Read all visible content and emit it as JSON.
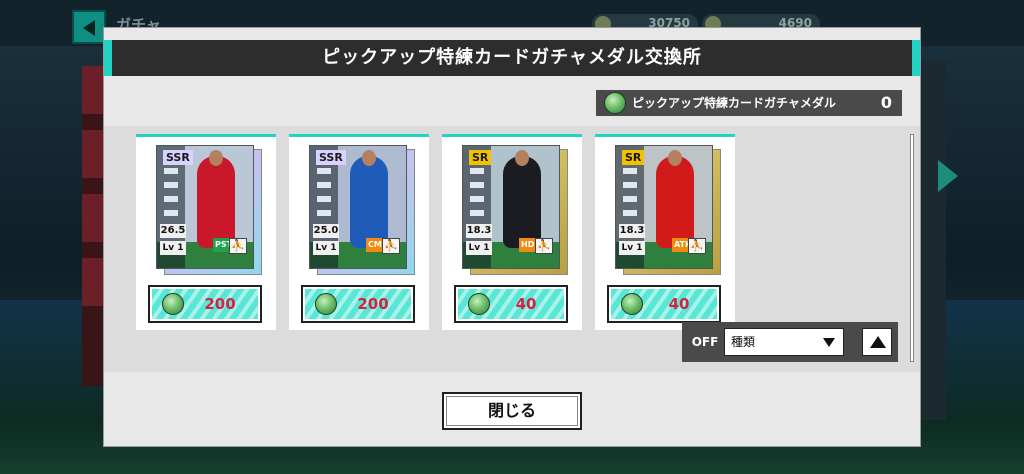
{
  "background": {
    "title": "ガチャ",
    "coin_a": "30750",
    "coin_b": "4690"
  },
  "dialog": {
    "title": "ピックアップ特練カードガチャメダル交換所",
    "medal": {
      "label": "ピックアップ特練カードガチャメダル",
      "count": "0",
      "icon": "medal-icon"
    },
    "cards": [
      {
        "rarity": "SSR",
        "rating": "26.5",
        "level": "Lv 1",
        "position": "PST",
        "position_color": "#1aa54a",
        "price": "200",
        "kit_color": "#c8182a",
        "art_bg": "#b9c7d6"
      },
      {
        "rarity": "SSR",
        "rating": "25.0",
        "level": "Lv 1",
        "position": "CMF",
        "position_color": "#f08a10",
        "price": "200",
        "kit_color": "#1f5bb8",
        "art_bg": "#aebacf"
      },
      {
        "rarity": "SR",
        "rating": "18.3",
        "level": "Lv 1",
        "position": "HDM",
        "position_color": "#f08a10",
        "price": "40",
        "kit_color": "#1b1b22",
        "art_bg": "#b0c2cc"
      },
      {
        "rarity": "SR",
        "rating": "18.3",
        "level": "Lv 1",
        "position": "ATK",
        "position_color": "#f08a10",
        "price": "40",
        "kit_color": "#d11a1a",
        "art_bg": "#bcc4c8"
      }
    ],
    "filter": {
      "off_label": "OFF",
      "select_value": "種類"
    },
    "close_label": "閉じる"
  }
}
